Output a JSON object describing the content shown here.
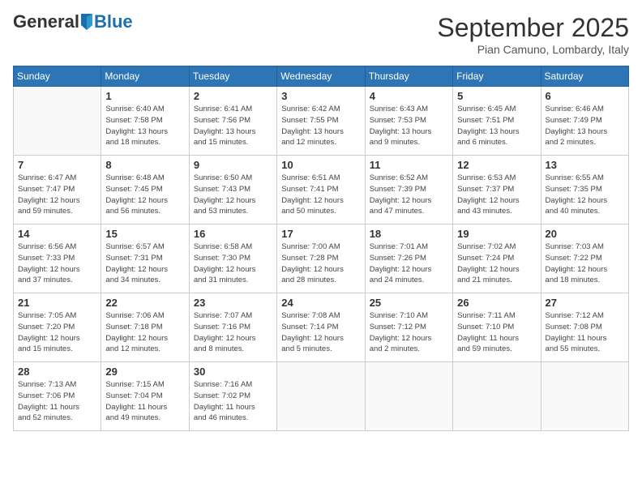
{
  "header": {
    "logo_general": "General",
    "logo_blue": "Blue",
    "month_title": "September 2025",
    "location": "Pian Camuno, Lombardy, Italy"
  },
  "days_of_week": [
    "Sunday",
    "Monday",
    "Tuesday",
    "Wednesday",
    "Thursday",
    "Friday",
    "Saturday"
  ],
  "weeks": [
    [
      {
        "day": "",
        "info": ""
      },
      {
        "day": "1",
        "info": "Sunrise: 6:40 AM\nSunset: 7:58 PM\nDaylight: 13 hours\nand 18 minutes."
      },
      {
        "day": "2",
        "info": "Sunrise: 6:41 AM\nSunset: 7:56 PM\nDaylight: 13 hours\nand 15 minutes."
      },
      {
        "day": "3",
        "info": "Sunrise: 6:42 AM\nSunset: 7:55 PM\nDaylight: 13 hours\nand 12 minutes."
      },
      {
        "day": "4",
        "info": "Sunrise: 6:43 AM\nSunset: 7:53 PM\nDaylight: 13 hours\nand 9 minutes."
      },
      {
        "day": "5",
        "info": "Sunrise: 6:45 AM\nSunset: 7:51 PM\nDaylight: 13 hours\nand 6 minutes."
      },
      {
        "day": "6",
        "info": "Sunrise: 6:46 AM\nSunset: 7:49 PM\nDaylight: 13 hours\nand 2 minutes."
      }
    ],
    [
      {
        "day": "7",
        "info": "Sunrise: 6:47 AM\nSunset: 7:47 PM\nDaylight: 12 hours\nand 59 minutes."
      },
      {
        "day": "8",
        "info": "Sunrise: 6:48 AM\nSunset: 7:45 PM\nDaylight: 12 hours\nand 56 minutes."
      },
      {
        "day": "9",
        "info": "Sunrise: 6:50 AM\nSunset: 7:43 PM\nDaylight: 12 hours\nand 53 minutes."
      },
      {
        "day": "10",
        "info": "Sunrise: 6:51 AM\nSunset: 7:41 PM\nDaylight: 12 hours\nand 50 minutes."
      },
      {
        "day": "11",
        "info": "Sunrise: 6:52 AM\nSunset: 7:39 PM\nDaylight: 12 hours\nand 47 minutes."
      },
      {
        "day": "12",
        "info": "Sunrise: 6:53 AM\nSunset: 7:37 PM\nDaylight: 12 hours\nand 43 minutes."
      },
      {
        "day": "13",
        "info": "Sunrise: 6:55 AM\nSunset: 7:35 PM\nDaylight: 12 hours\nand 40 minutes."
      }
    ],
    [
      {
        "day": "14",
        "info": "Sunrise: 6:56 AM\nSunset: 7:33 PM\nDaylight: 12 hours\nand 37 minutes."
      },
      {
        "day": "15",
        "info": "Sunrise: 6:57 AM\nSunset: 7:31 PM\nDaylight: 12 hours\nand 34 minutes."
      },
      {
        "day": "16",
        "info": "Sunrise: 6:58 AM\nSunset: 7:30 PM\nDaylight: 12 hours\nand 31 minutes."
      },
      {
        "day": "17",
        "info": "Sunrise: 7:00 AM\nSunset: 7:28 PM\nDaylight: 12 hours\nand 28 minutes."
      },
      {
        "day": "18",
        "info": "Sunrise: 7:01 AM\nSunset: 7:26 PM\nDaylight: 12 hours\nand 24 minutes."
      },
      {
        "day": "19",
        "info": "Sunrise: 7:02 AM\nSunset: 7:24 PM\nDaylight: 12 hours\nand 21 minutes."
      },
      {
        "day": "20",
        "info": "Sunrise: 7:03 AM\nSunset: 7:22 PM\nDaylight: 12 hours\nand 18 minutes."
      }
    ],
    [
      {
        "day": "21",
        "info": "Sunrise: 7:05 AM\nSunset: 7:20 PM\nDaylight: 12 hours\nand 15 minutes."
      },
      {
        "day": "22",
        "info": "Sunrise: 7:06 AM\nSunset: 7:18 PM\nDaylight: 12 hours\nand 12 minutes."
      },
      {
        "day": "23",
        "info": "Sunrise: 7:07 AM\nSunset: 7:16 PM\nDaylight: 12 hours\nand 8 minutes."
      },
      {
        "day": "24",
        "info": "Sunrise: 7:08 AM\nSunset: 7:14 PM\nDaylight: 12 hours\nand 5 minutes."
      },
      {
        "day": "25",
        "info": "Sunrise: 7:10 AM\nSunset: 7:12 PM\nDaylight: 12 hours\nand 2 minutes."
      },
      {
        "day": "26",
        "info": "Sunrise: 7:11 AM\nSunset: 7:10 PM\nDaylight: 11 hours\nand 59 minutes."
      },
      {
        "day": "27",
        "info": "Sunrise: 7:12 AM\nSunset: 7:08 PM\nDaylight: 11 hours\nand 55 minutes."
      }
    ],
    [
      {
        "day": "28",
        "info": "Sunrise: 7:13 AM\nSunset: 7:06 PM\nDaylight: 11 hours\nand 52 minutes."
      },
      {
        "day": "29",
        "info": "Sunrise: 7:15 AM\nSunset: 7:04 PM\nDaylight: 11 hours\nand 49 minutes."
      },
      {
        "day": "30",
        "info": "Sunrise: 7:16 AM\nSunset: 7:02 PM\nDaylight: 11 hours\nand 46 minutes."
      },
      {
        "day": "",
        "info": ""
      },
      {
        "day": "",
        "info": ""
      },
      {
        "day": "",
        "info": ""
      },
      {
        "day": "",
        "info": ""
      }
    ]
  ]
}
